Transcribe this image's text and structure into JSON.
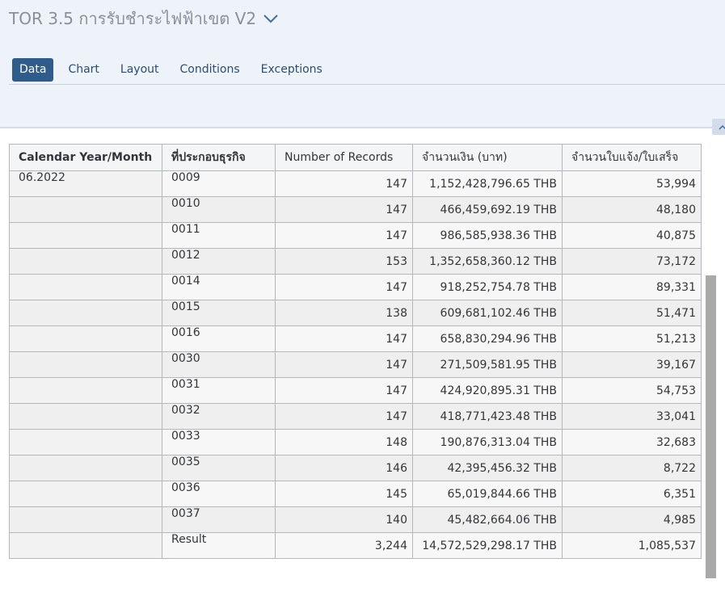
{
  "header": {
    "title": "TOR 3.5 การรับชำระไฟฟ้าเขต V2",
    "chevron_icon": "chevron-down-icon"
  },
  "tabs": [
    {
      "label": "Data",
      "active": true
    },
    {
      "label": "Chart",
      "active": false
    },
    {
      "label": "Layout",
      "active": false
    },
    {
      "label": "Conditions",
      "active": false
    },
    {
      "label": "Exceptions",
      "active": false
    }
  ],
  "table": {
    "columns": [
      "Calendar Year/Month",
      "ที่ประกอบธุรกิจ",
      "Number of Records",
      "จำนวนเงิน (บาท)",
      "จำนวนใบแจ้ง/ใบเสร็จ"
    ],
    "rows": [
      {
        "month": "06.2022",
        "site": "0009",
        "records": "147",
        "amount": "1,152,428,796.65 THB",
        "receipts": "53,994"
      },
      {
        "month": "",
        "site": "0010",
        "records": "147",
        "amount": "466,459,692.19 THB",
        "receipts": "48,180"
      },
      {
        "month": "",
        "site": "0011",
        "records": "147",
        "amount": "986,585,938.36 THB",
        "receipts": "40,875"
      },
      {
        "month": "",
        "site": "0012",
        "records": "153",
        "amount": "1,352,658,360.12 THB",
        "receipts": "73,172"
      },
      {
        "month": "",
        "site": "0014",
        "records": "147",
        "amount": "918,252,754.78 THB",
        "receipts": "89,331"
      },
      {
        "month": "",
        "site": "0015",
        "records": "138",
        "amount": "609,681,102.46 THB",
        "receipts": "51,471"
      },
      {
        "month": "",
        "site": "0016",
        "records": "147",
        "amount": "658,830,294.96 THB",
        "receipts": "51,213"
      },
      {
        "month": "",
        "site": "0030",
        "records": "147",
        "amount": "271,509,581.95 THB",
        "receipts": "39,167"
      },
      {
        "month": "",
        "site": "0031",
        "records": "147",
        "amount": "424,920,895.31 THB",
        "receipts": "54,753"
      },
      {
        "month": "",
        "site": "0032",
        "records": "147",
        "amount": "418,771,423.48 THB",
        "receipts": "33,041"
      },
      {
        "month": "",
        "site": "0033",
        "records": "148",
        "amount": "190,876,313.04 THB",
        "receipts": "32,683"
      },
      {
        "month": "",
        "site": "0035",
        "records": "146",
        "amount": "42,395,456.32 THB",
        "receipts": "8,722"
      },
      {
        "month": "",
        "site": "0036",
        "records": "145",
        "amount": "65,019,844.66 THB",
        "receipts": "6,351"
      },
      {
        "month": "",
        "site": "0037",
        "records": "140",
        "amount": "45,482,664.06 THB",
        "receipts": "4,985"
      }
    ],
    "result": {
      "label": "Result",
      "records": "3,244",
      "amount": "14,572,529,298.17 THB",
      "receipts": "1,085,537"
    }
  }
}
